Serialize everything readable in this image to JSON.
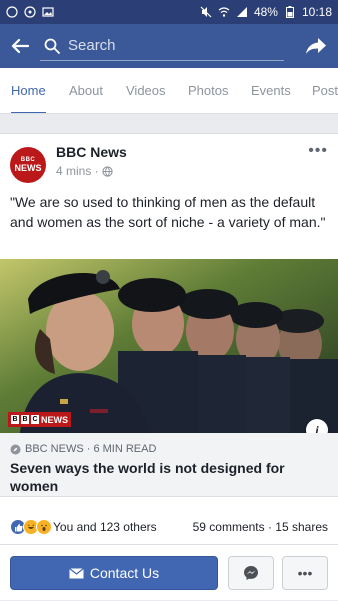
{
  "status_bar": {
    "battery": "48%",
    "time": "10:18"
  },
  "search": {
    "placeholder": "Search"
  },
  "tabs": [
    "Home",
    "About",
    "Videos",
    "Photos",
    "Events",
    "Posts"
  ],
  "post": {
    "page_name": "BBC News",
    "avatar_text_top": "BBC",
    "avatar_text_bottom": "NEWS",
    "time": "4 mins ·",
    "text": "\"We are so used to thinking of men as the default and women as the sort of niche - a variety of man.\"",
    "badge": "NEWS",
    "link_source": "BBC NEWS · 6 MIN READ",
    "link_title": "Seven ways the world is not designed for women",
    "reactions_text": "You and 123 others",
    "comments_shares": "59 comments · 15 shares",
    "contact_label": "Contact Us"
  },
  "colors": {
    "brand": "#3b5998",
    "accent": "#4267b2",
    "bbc_red": "#bb1919"
  }
}
